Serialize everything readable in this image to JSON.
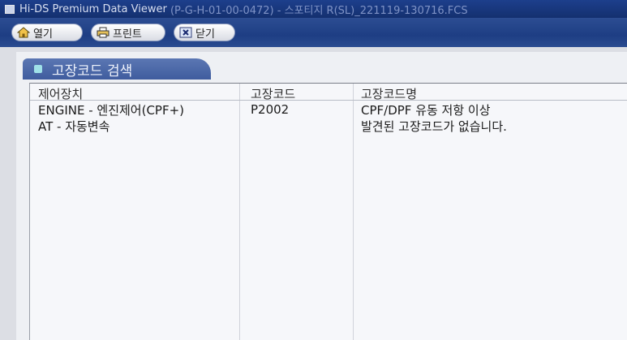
{
  "window": {
    "title_app": "Hi-DS Premium Data Viewer",
    "title_rest": "(P-G-H-01-00-0472) - 스포티지 R(SL)_221119-130716.FCS"
  },
  "toolbar": {
    "open_label": "열기",
    "print_label": "프린트",
    "close_label": "닫기"
  },
  "section": {
    "title": "고장코드 검색"
  },
  "table": {
    "headers": [
      "제어장치",
      "고장코드",
      "고장코드명"
    ],
    "rows": [
      [
        "ENGINE - 엔진제어(CPF+)",
        "P2002",
        "CPF/DPF 유동 저항 이상"
      ],
      [
        "AT - 자동변속",
        "",
        "발견된 고장코드가 없습니다."
      ]
    ]
  }
}
